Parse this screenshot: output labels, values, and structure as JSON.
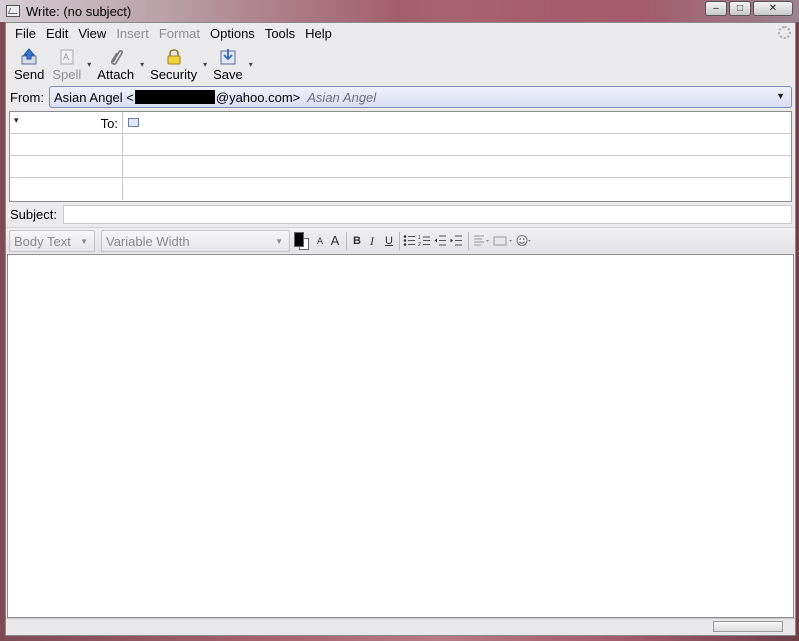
{
  "window": {
    "title": "Write: (no subject)",
    "minimize": "–",
    "maximize": "□",
    "close": "✕"
  },
  "menu": [
    "File",
    "Edit",
    "View",
    "Insert",
    "Format",
    "Options",
    "Tools",
    "Help"
  ],
  "menu_disabled": [
    "Insert",
    "Format"
  ],
  "toolbar": {
    "send": "Send",
    "spell": "Spell",
    "attach": "Attach",
    "security": "Security",
    "save": "Save"
  },
  "from": {
    "label": "From:",
    "name_prefix": "Asian Angel <",
    "email_suffix": "@yahoo.com>",
    "identity_hint": "Asian Angel"
  },
  "addressing": {
    "type_label": "To:"
  },
  "subject": {
    "label": "Subject:",
    "value": ""
  },
  "format": {
    "paragraph": "Body Text",
    "font": "Variable Width",
    "bold": "B",
    "italic": "I",
    "underline": "U",
    "smaller": "A",
    "larger": "A",
    "color_fg": "#000000",
    "color_bg": "#ffffff"
  },
  "icons": [
    "send-icon",
    "spell-icon",
    "attach-icon",
    "security-icon",
    "save-icon",
    "address-card-icon",
    "throbber-icon"
  ]
}
